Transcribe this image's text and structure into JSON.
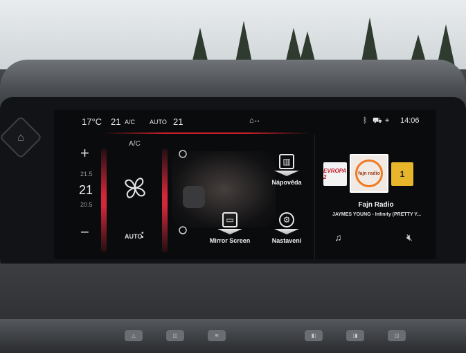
{
  "status_bar": {
    "temp_outside": "17°C",
    "temp_zone": "21",
    "ac_label": "A/C",
    "auto_label": "AUTO",
    "temp_right": "21",
    "time": "14:06",
    "icons": [
      "bluetooth-icon",
      "car-connect-icon",
      "location-icon"
    ]
  },
  "climate": {
    "ac_label": "A/C",
    "temp_upper": "21.5",
    "temp_current": "21",
    "temp_lower": "20.5",
    "auto_label": "AUTO",
    "plus_label": "+",
    "minus_label": "−"
  },
  "shortcuts": [
    {
      "label": "Nápověda",
      "icon": "book-icon"
    },
    {
      "label": "Mirror Screen",
      "icon": "mirror-screen-icon"
    },
    {
      "label": "Nastavení",
      "icon": "settings-gear-icon"
    }
  ],
  "media": {
    "stations": [
      {
        "label": "EVROPA 2",
        "icon": "evropa2-logo"
      },
      {
        "label": "fajn radio",
        "icon": "fajn-radio-logo"
      },
      {
        "label": "1",
        "icon": "radio-1-logo"
      }
    ],
    "station_name": "Fajn Radio",
    "track": "JAYMES YOUNG - Infinity (PRETTY Y..."
  },
  "colors": {
    "accent_red": "#d3283a",
    "screen_bg": "#0a0b0d",
    "text": "#f0f0f0"
  }
}
